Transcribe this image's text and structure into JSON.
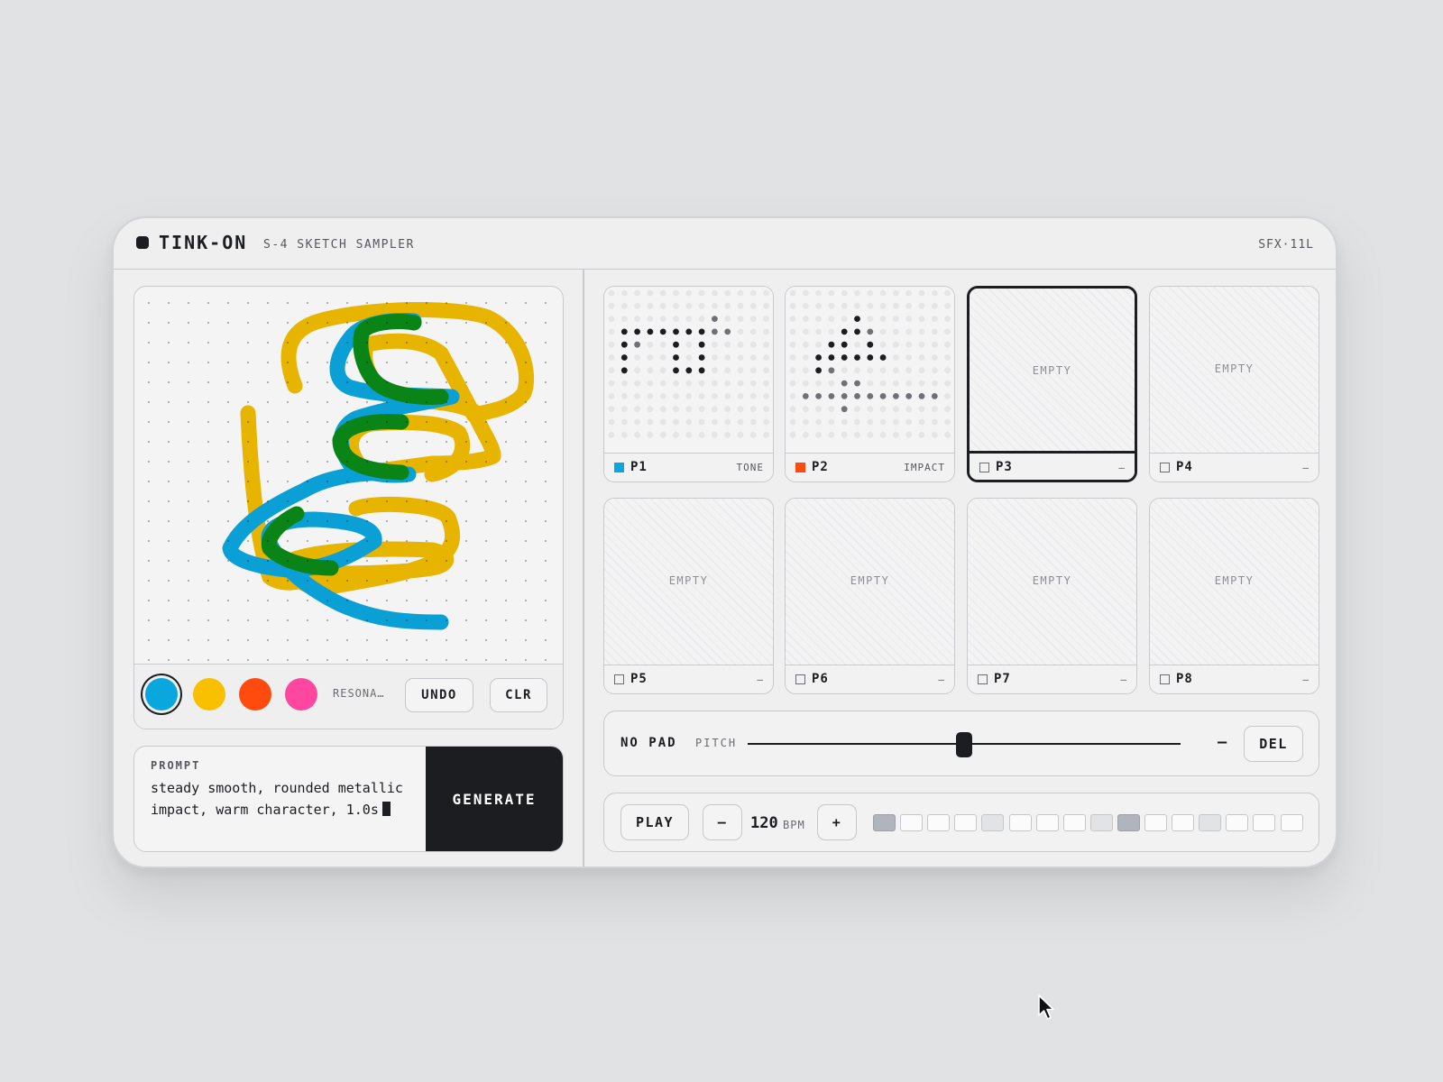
{
  "header": {
    "brand": "TINK-ON",
    "subtitle": "S-4 SKETCH SAMPLER",
    "model": "SFX·11L"
  },
  "sketch": {
    "colors": {
      "blue": "#0aa7de",
      "yellow": "#f2bc00",
      "green": "#0a8a16",
      "orange": "#ff4b0d",
      "pink": "#ff47a0"
    },
    "swatches": [
      {
        "name": "blue",
        "color": "#0aa7de",
        "selected": true
      },
      {
        "name": "yellow",
        "color": "#f8c000",
        "selected": false
      },
      {
        "name": "orange",
        "color": "#ff4b0d",
        "selected": false
      },
      {
        "name": "pink",
        "color": "#ff47a0",
        "selected": false
      }
    ],
    "preset_label": "RESONA…",
    "undo_label": "UNDO",
    "clear_label": "CLR"
  },
  "prompt": {
    "label": "PROMPT",
    "text": "steady smooth, rounded metallic impact, warm character, 1.0s",
    "generate_label": "GENERATE"
  },
  "pads": [
    {
      "name": "P1",
      "tag": "TONE",
      "color": "#0aa7de",
      "empty": false
    },
    {
      "name": "P2",
      "tag": "IMPACT",
      "color": "#ff4b0d",
      "empty": false
    },
    {
      "name": "P3",
      "tag": "–",
      "color": "",
      "empty": true,
      "selected": true
    },
    {
      "name": "P4",
      "tag": "–",
      "color": "",
      "empty": true
    },
    {
      "name": "P5",
      "tag": "–",
      "color": "",
      "empty": true
    },
    {
      "name": "P6",
      "tag": "–",
      "color": "",
      "empty": true
    },
    {
      "name": "P7",
      "tag": "–",
      "color": "",
      "empty": true
    },
    {
      "name": "P8",
      "tag": "–",
      "color": "",
      "empty": true
    }
  ],
  "empty_label": "EMPTY",
  "pitch": {
    "pad_label": "NO PAD",
    "label": "PITCH",
    "level": 0.5,
    "value": "–",
    "delete_label": "DEL"
  },
  "sequencer": {
    "play_label": "PLAY",
    "minus_label": "–",
    "bpm": "120",
    "bpm_unit": "BPM",
    "plus_label": "+",
    "steps": [
      "on",
      "off",
      "off",
      "off",
      "accent",
      "off",
      "off",
      "off",
      "accent",
      "on",
      "off",
      "off",
      "accent",
      "off",
      "off",
      "off"
    ]
  }
}
